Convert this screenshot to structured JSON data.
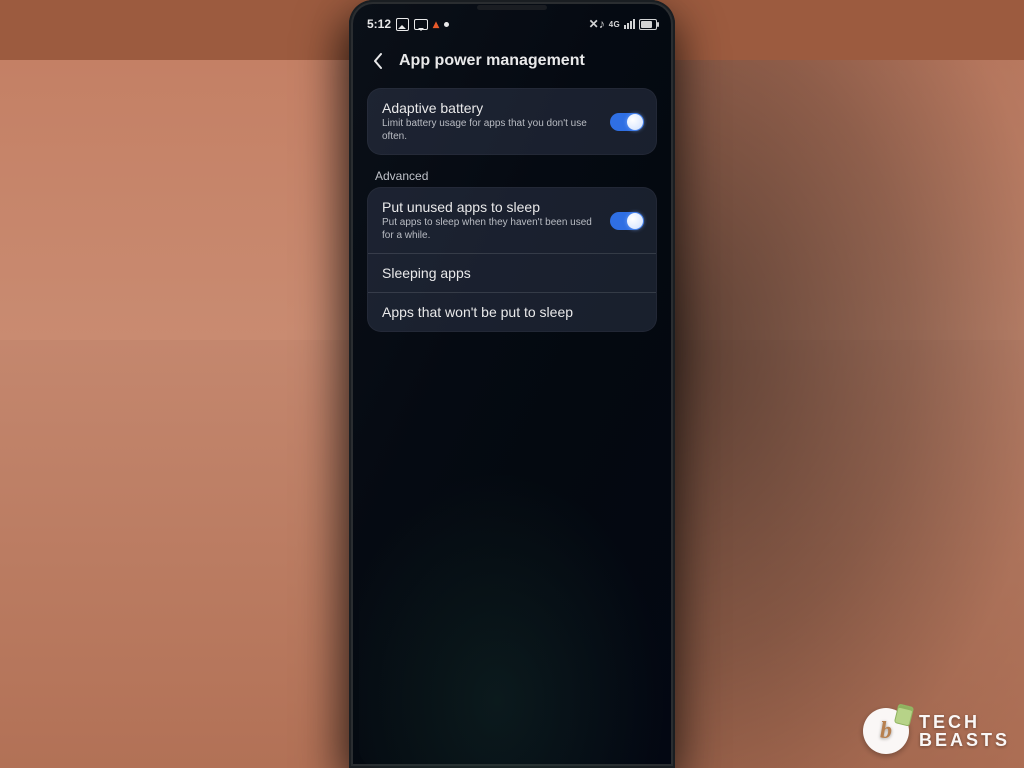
{
  "status_bar": {
    "time": "5:12",
    "network_label": "4G",
    "battery_icon": "battery-icon",
    "signal_icon": "signal-icon",
    "mute_icon": "mute-icon"
  },
  "header": {
    "back_icon": "chevron-left-icon",
    "title": "App power management"
  },
  "card1": {
    "adaptive_battery": {
      "title": "Adaptive battery",
      "subtitle": "Limit battery usage for apps that you don't use often.",
      "toggle_on": true
    }
  },
  "section_advanced_label": "Advanced",
  "card2": {
    "put_unused_sleep": {
      "title": "Put unused apps to sleep",
      "subtitle": "Put apps to sleep when they haven't been used for a while.",
      "toggle_on": true
    },
    "sleeping_apps": {
      "title": "Sleeping apps"
    },
    "never_sleep": {
      "title": "Apps that won't be put to sleep"
    }
  },
  "watermark": {
    "logo_letter": "b",
    "line1": "TECH",
    "line2": "BEASTS"
  },
  "colors": {
    "toggle_on": "#2f6fe3",
    "card_bg": "rgba(70,82,110,0.32)"
  }
}
